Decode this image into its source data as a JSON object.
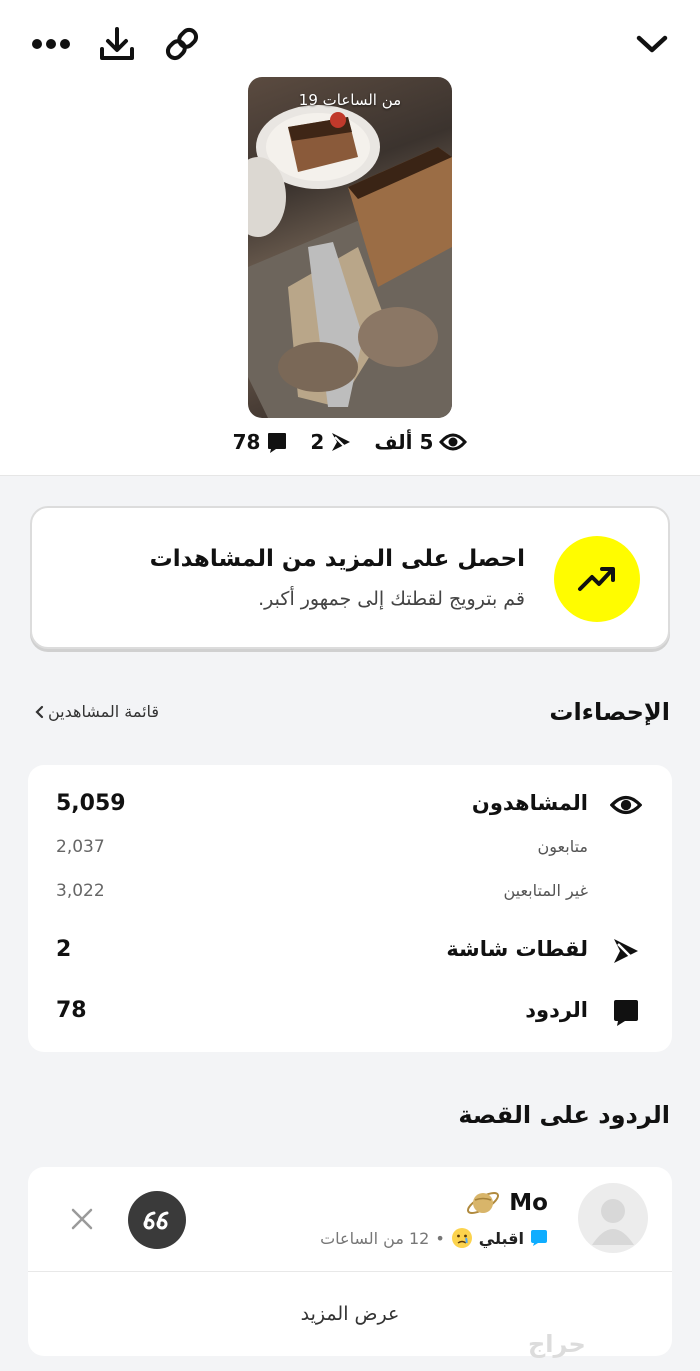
{
  "story": {
    "time_ago": "19 من الساعات",
    "views": "5 ألف",
    "screenshots": "2",
    "replies": "78"
  },
  "promo": {
    "title": "احصل على المزيد من المشاهدات",
    "subtitle": "قم بترويج لقطتك إلى جمهور أكبر."
  },
  "stats": {
    "title": "الإحصاءات",
    "viewers_list_link": "قائمة المشاهدين",
    "viewers_label": "المشاهدون",
    "viewers_value": "5,059",
    "followers_label": "متابعون",
    "followers_value": "2,037",
    "non_followers_label": "غير المتابعين",
    "non_followers_value": "3,022",
    "screenshots_label": "لقطات شاشة",
    "screenshots_value": "2",
    "replies_label": "الردود",
    "replies_value": "78"
  },
  "replies_section": {
    "title": "الردود على القصة",
    "reply": {
      "name": "Mo",
      "text": "اقبلي",
      "time": "12 من الساعات"
    },
    "show_more": "عرض المزيد"
  },
  "watermark": "حراج",
  "colors": {
    "accent_yellow": "#fffc00",
    "chat_blue": "#0fadff",
    "page_bg": "#f3f4f6"
  }
}
